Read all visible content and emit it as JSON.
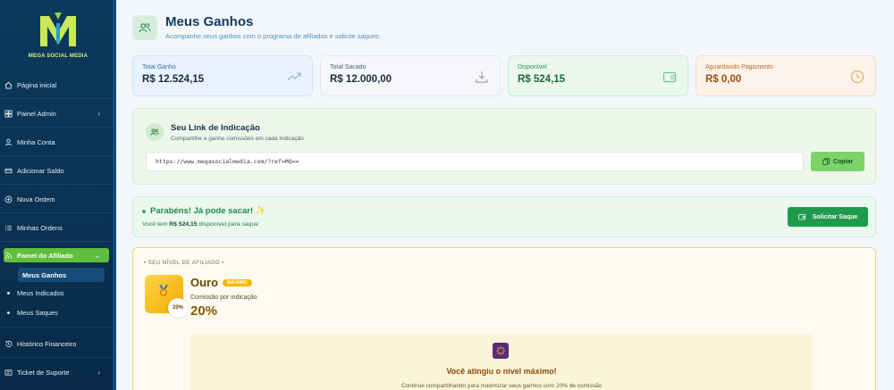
{
  "brand": {
    "name": "MEGA SOCIAL MEDIA",
    "mark": "M"
  },
  "sidebar": {
    "items": [
      {
        "label": "Página inicial",
        "icon": "home-icon"
      },
      {
        "label": "Painel Admin",
        "icon": "dashboard-icon",
        "chevron": "›"
      },
      {
        "label": "Minha Conta",
        "icon": "user-icon"
      },
      {
        "label": "Adicionar Saldo",
        "icon": "card-icon"
      },
      {
        "label": "Nova Ordem",
        "icon": "plus-circle-icon"
      },
      {
        "label": "Minhas Ordens",
        "icon": "list-icon"
      },
      {
        "label": "Painel do Afiliado",
        "icon": "rss-icon",
        "chevron": "⌄"
      },
      {
        "label": "Histórico Financeiro",
        "icon": "history-icon"
      },
      {
        "label": "Ticket de Suporte",
        "icon": "ticket-icon",
        "chevron": "›"
      }
    ],
    "subitems": [
      {
        "label": "Meus Ganhos"
      },
      {
        "label": "Meus Indicados"
      },
      {
        "label": "Meus Saques"
      }
    ]
  },
  "header": {
    "title": "Meus Ganhos",
    "subtitle": "Acompanhe seus ganhos com o programa de afiliados e solicite saques."
  },
  "stats": [
    {
      "label": "Total Ganho",
      "value": "R$ 12.524,15",
      "icon": "trend-up-icon"
    },
    {
      "label": "Total Sacado",
      "value": "R$ 12.000,00",
      "icon": "download-icon"
    },
    {
      "label": "Disponível",
      "value": "R$ 524,15",
      "icon": "wallet-icon"
    },
    {
      "label": "Aguardando Pagamento",
      "value": "R$ 0,00",
      "icon": "clock-icon"
    }
  ],
  "referral": {
    "title": "Seu Link de Indicação",
    "subtitle": "Compartilhe e ganhe comissões em cada indicação",
    "link": "https://www.megasocialmedia.com/?ref=MQ==",
    "copy_label": "Copiar"
  },
  "withdraw": {
    "title": "Parabéns! Já pode sacar! ✨",
    "sub_prefix": "Você tem",
    "sub_amount": "R$ 524,15",
    "sub_suffix": "disponível para saque",
    "button_label": "Solicitar Saque"
  },
  "level": {
    "caption": "• SEU NÍVEL DE AFILIADO •",
    "name": "Ouro",
    "badge": "MÁXIMO",
    "medal_pct": "20%",
    "commission_label": "Comissão por indicação",
    "commission_value": "20%",
    "max_title": "Você atingiu o nível máximo!",
    "max_sub": "Continue compartilhando para maximizar seus ganhos com 20% de comissão"
  },
  "colors": {
    "accent": "#5fbf3c",
    "sidebar": "#0b3a5c",
    "success": "#1f9a4c",
    "gold": "#f2d36a"
  }
}
